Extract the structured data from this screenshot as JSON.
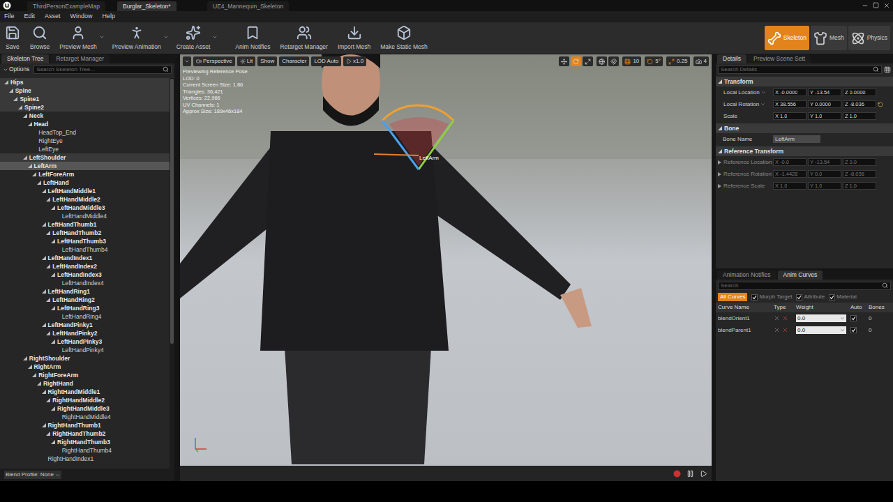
{
  "window": {
    "tabs": [
      {
        "label": "ThirdPersonExampleMap",
        "selected": false
      },
      {
        "label": "Burglar_Skeleton*",
        "selected": true
      },
      {
        "label": "UE4_Mannequin_Skeleton",
        "selected": false
      }
    ]
  },
  "menu": [
    "File",
    "Edit",
    "Asset",
    "Window",
    "Help"
  ],
  "toolbar": [
    {
      "label": "Save",
      "dropdown": false
    },
    {
      "label": "Browse",
      "dropdown": false
    },
    {
      "label": "Preview Mesh",
      "dropdown": true
    },
    {
      "label": "Preview Animation",
      "dropdown": true
    },
    {
      "label": "Create Asset",
      "dropdown": true
    },
    {
      "label": "Anim Notifies",
      "dropdown": false
    },
    {
      "label": "Retarget Manager",
      "dropdown": false
    },
    {
      "label": "Import Mesh",
      "dropdown": false
    },
    {
      "label": "Make Static Mesh",
      "dropdown": false
    }
  ],
  "modes": [
    {
      "label": "Skeleton",
      "selected": true
    },
    {
      "label": "Mesh",
      "selected": false
    },
    {
      "label": "Physics",
      "selected": false
    }
  ],
  "skeleton_panel": {
    "tabs": [
      {
        "label": "Skeleton Tree",
        "selected": true
      },
      {
        "label": "Retarget Manager",
        "selected": false
      }
    ],
    "options": "Options",
    "search": {
      "placeholder": "Search Skeleton Tree..."
    },
    "bones": [
      {
        "name": "Hips",
        "depth": 0,
        "selected": false
      },
      {
        "name": "Spine",
        "depth": 1,
        "selected": false
      },
      {
        "name": "Spine1",
        "depth": 2,
        "selected": false
      },
      {
        "name": "Spine2",
        "depth": 3,
        "selected": false
      },
      {
        "name": "Neck",
        "depth": 4,
        "selected": false
      },
      {
        "name": "Head",
        "depth": 5,
        "selected": false
      },
      {
        "name": "HeadTop_End",
        "depth": 6,
        "selected": false
      },
      {
        "name": "RightEye",
        "depth": 6,
        "selected": false
      },
      {
        "name": "LeftEye",
        "depth": 6,
        "selected": false
      },
      {
        "name": "LeftShoulder",
        "depth": 4,
        "selected": false
      },
      {
        "name": "LeftArm",
        "depth": 5,
        "selected": true
      },
      {
        "name": "LeftForeArm",
        "depth": 6,
        "selected": false
      },
      {
        "name": "LeftHand",
        "depth": 7,
        "selected": false
      },
      {
        "name": "LeftHandMiddle1",
        "depth": 8,
        "selected": false
      },
      {
        "name": "LeftHandMiddle2",
        "depth": 9,
        "selected": false
      },
      {
        "name": "LeftHandMiddle3",
        "depth": 10,
        "selected": false
      },
      {
        "name": "LeftHandMiddle4",
        "depth": 11,
        "selected": false
      },
      {
        "name": "LeftHandThumb1",
        "depth": 8,
        "selected": false
      },
      {
        "name": "LeftHandThumb2",
        "depth": 9,
        "selected": false
      },
      {
        "name": "LeftHandThumb3",
        "depth": 10,
        "selected": false
      },
      {
        "name": "LeftHandThumb4",
        "depth": 11,
        "selected": false
      },
      {
        "name": "LeftHandIndex1",
        "depth": 8,
        "selected": false
      },
      {
        "name": "LeftHandIndex2",
        "depth": 9,
        "selected": false
      },
      {
        "name": "LeftHandIndex3",
        "depth": 10,
        "selected": false
      },
      {
        "name": "LeftHandIndex4",
        "depth": 11,
        "selected": false
      },
      {
        "name": "LeftHandRing1",
        "depth": 8,
        "selected": false
      },
      {
        "name": "LeftHandRing2",
        "depth": 9,
        "selected": false
      },
      {
        "name": "LeftHandRing3",
        "depth": 10,
        "selected": false
      },
      {
        "name": "LeftHandRing4",
        "depth": 11,
        "selected": false
      },
      {
        "name": "LeftHandPinky1",
        "depth": 8,
        "selected": false
      },
      {
        "name": "LeftHandPinky2",
        "depth": 9,
        "selected": false
      },
      {
        "name": "LeftHandPinky3",
        "depth": 10,
        "selected": false
      },
      {
        "name": "LeftHandPinky4",
        "depth": 11,
        "selected": false
      },
      {
        "name": "RightShoulder",
        "depth": 4,
        "selected": false
      },
      {
        "name": "RightArm",
        "depth": 5,
        "selected": false
      },
      {
        "name": "RightForeArm",
        "depth": 6,
        "selected": false
      },
      {
        "name": "RightHand",
        "depth": 7,
        "selected": false
      },
      {
        "name": "RightHandMiddle1",
        "depth": 8,
        "selected": false
      },
      {
        "name": "RightHandMiddle2",
        "depth": 9,
        "selected": false
      },
      {
        "name": "RightHandMiddle3",
        "depth": 10,
        "selected": false
      },
      {
        "name": "RightHandMiddle4",
        "depth": 11,
        "selected": false
      },
      {
        "name": "RightHandThumb1",
        "depth": 8,
        "selected": false
      },
      {
        "name": "RightHandThumb2",
        "depth": 9,
        "selected": false
      },
      {
        "name": "RightHandThumb3",
        "depth": 10,
        "selected": false
      },
      {
        "name": "RightHandThumb4",
        "depth": 11,
        "selected": false
      },
      {
        "name": "RightHandIndex1",
        "depth": 8,
        "selected": false
      }
    ],
    "blend_profile": "Blend Profile: None"
  },
  "viewport": {
    "toolbar_left": [
      "Perspective",
      "Lit",
      "Show",
      "Character",
      "LOD Auto",
      "x1.0"
    ],
    "transform_tools": [
      {
        "selected": false
      },
      {
        "selected": true
      },
      {
        "selected": false
      }
    ],
    "snaps": [
      {
        "value": "10",
        "enabled": true
      },
      {
        "value": "5°",
        "enabled": true
      },
      {
        "value": "0.25",
        "enabled": true
      }
    ],
    "camera_speed": "4",
    "info": [
      "Previewing Reference Pose",
      "LOD: 0",
      "Current Screen Size: 1.86",
      "Triangles: 36,421",
      "Vertices: 22,966",
      "UV Channels: 1",
      "Approx Size: 189x46x184"
    ],
    "bone_label": "LeftArm"
  },
  "details": {
    "tabs": [
      {
        "label": "Details",
        "selected": true
      },
      {
        "label": "Preview Scene Sett",
        "selected": false
      }
    ],
    "search": {
      "placeholder": "Search Details"
    },
    "sections": [
      {
        "title": "Transform",
        "rows": [
          {
            "kind": "vector",
            "label": "Local Location",
            "dropdown": true,
            "expanded": true,
            "modified": false,
            "disabled": false,
            "values": [
              {
                "axis": "X",
                "value": "-0.0000"
              },
              {
                "axis": "Y",
                "value": "-13.54"
              },
              {
                "axis": "Z",
                "value": "0.0000"
              }
            ]
          },
          {
            "kind": "vector",
            "label": "Local Rotation",
            "dropdown": true,
            "expanded": true,
            "modified": true,
            "disabled": false,
            "values": [
              {
                "axis": "X",
                "value": "38.556"
              },
              {
                "axis": "Y",
                "value": "0.0000"
              },
              {
                "axis": "Z",
                "value": "-8.036"
              }
            ]
          },
          {
            "kind": "vector",
            "label": "Scale",
            "dropdown": false,
            "expanded": true,
            "modified": false,
            "disabled": false,
            "values": [
              {
                "axis": "X",
                "value": "1.0"
              },
              {
                "axis": "Y",
                "value": "1.0"
              },
              {
                "axis": "Z",
                "value": "1.0"
              }
            ]
          }
        ]
      },
      {
        "title": "Bone",
        "rows": [
          {
            "kind": "text",
            "label": "Bone Name",
            "value": "LeftArm"
          }
        ]
      },
      {
        "title": "Reference Transform",
        "rows": [
          {
            "kind": "vector",
            "label": "Reference Location",
            "dropdown": false,
            "expanded": false,
            "modified": false,
            "disabled": true,
            "values": [
              {
                "axis": "X",
                "value": "-0.0"
              },
              {
                "axis": "Y",
                "value": "-13.54"
              },
              {
                "axis": "Z",
                "value": "0.0"
              }
            ]
          },
          {
            "kind": "vector",
            "label": "Reference Rotation",
            "dropdown": false,
            "expanded": false,
            "modified": false,
            "disabled": true,
            "values": [
              {
                "axis": "X",
                "value": "-1.4428"
              },
              {
                "axis": "Y",
                "value": "0.0"
              },
              {
                "axis": "Z",
                "value": "-8.036"
              }
            ]
          },
          {
            "kind": "vector",
            "label": "Reference Scale",
            "dropdown": false,
            "expanded": false,
            "modified": false,
            "disabled": true,
            "values": [
              {
                "axis": "X",
                "value": "1.0"
              },
              {
                "axis": "Y",
                "value": "1.0"
              },
              {
                "axis": "Z",
                "value": "1.0"
              }
            ]
          }
        ]
      }
    ]
  },
  "anim": {
    "tabs": [
      {
        "label": "Animation Notifies",
        "selected": false
      },
      {
        "label": "Anim Curves",
        "selected": true
      }
    ],
    "search": {
      "placeholder": "Search"
    },
    "filters": [
      {
        "kind": "button",
        "label": "All Curves",
        "selected": true
      },
      {
        "kind": "checkbox",
        "label": "Morph Target",
        "checked": true
      },
      {
        "kind": "checkbox",
        "label": "Attribute",
        "checked": true
      },
      {
        "kind": "checkbox",
        "label": "Material",
        "checked": true
      }
    ],
    "columns": [
      "Curve Name",
      "Type",
      "Weight",
      "Auto",
      "Bones"
    ],
    "rows": [
      {
        "name": "blendOrient1",
        "weight": "0.0",
        "auto": true,
        "bones": "0"
      },
      {
        "name": "blendParent1",
        "weight": "0.0",
        "auto": true,
        "bones": "0"
      }
    ]
  }
}
